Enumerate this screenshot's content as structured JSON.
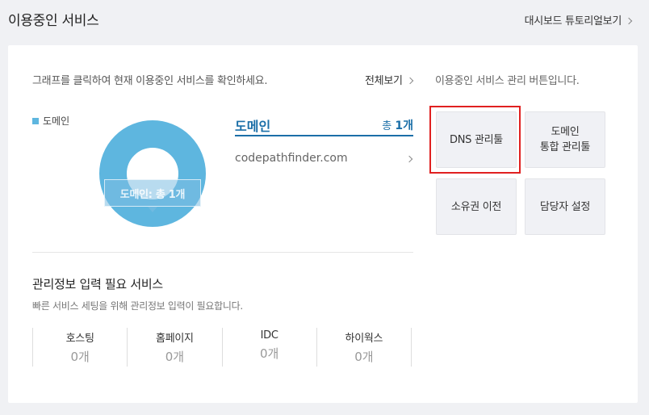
{
  "header": {
    "title": "이용중인 서비스",
    "tutorial_link": "대시보드 튜토리얼보기"
  },
  "graph_panel": {
    "instruction": "그래프를 클릭하여 현재 이용중인 서비스를 확인하세요.",
    "view_all": "전체보기",
    "legend_label": "도메인",
    "tooltip": "도메인: 총 1개",
    "accent_color": "#5eb6df"
  },
  "domain_list": {
    "title": "도메인",
    "total_prefix": "총 ",
    "total_value": "1개",
    "items": [
      {
        "name": "codepathfinder.com"
      }
    ]
  },
  "required_info": {
    "title": "관리정보 입력 필요 서비스",
    "subtitle": "빠른 서비스 세팅을 위해 관리정보 입력이 필요합니다.",
    "stats": [
      {
        "label": "호스팅",
        "value": "0개"
      },
      {
        "label": "홈페이지",
        "value": "0개"
      },
      {
        "label": "IDC",
        "value": "0개"
      },
      {
        "label": "하이웍스",
        "value": "0개"
      }
    ]
  },
  "management": {
    "caption": "이용중인 서비스 관리 버튼입니다.",
    "buttons": {
      "dns": "DNS 관리툴",
      "integrated_line1": "도메인",
      "integrated_line2": "통합 관리툴",
      "transfer": "소유권 이전",
      "contact": "담당자 설정"
    }
  }
}
